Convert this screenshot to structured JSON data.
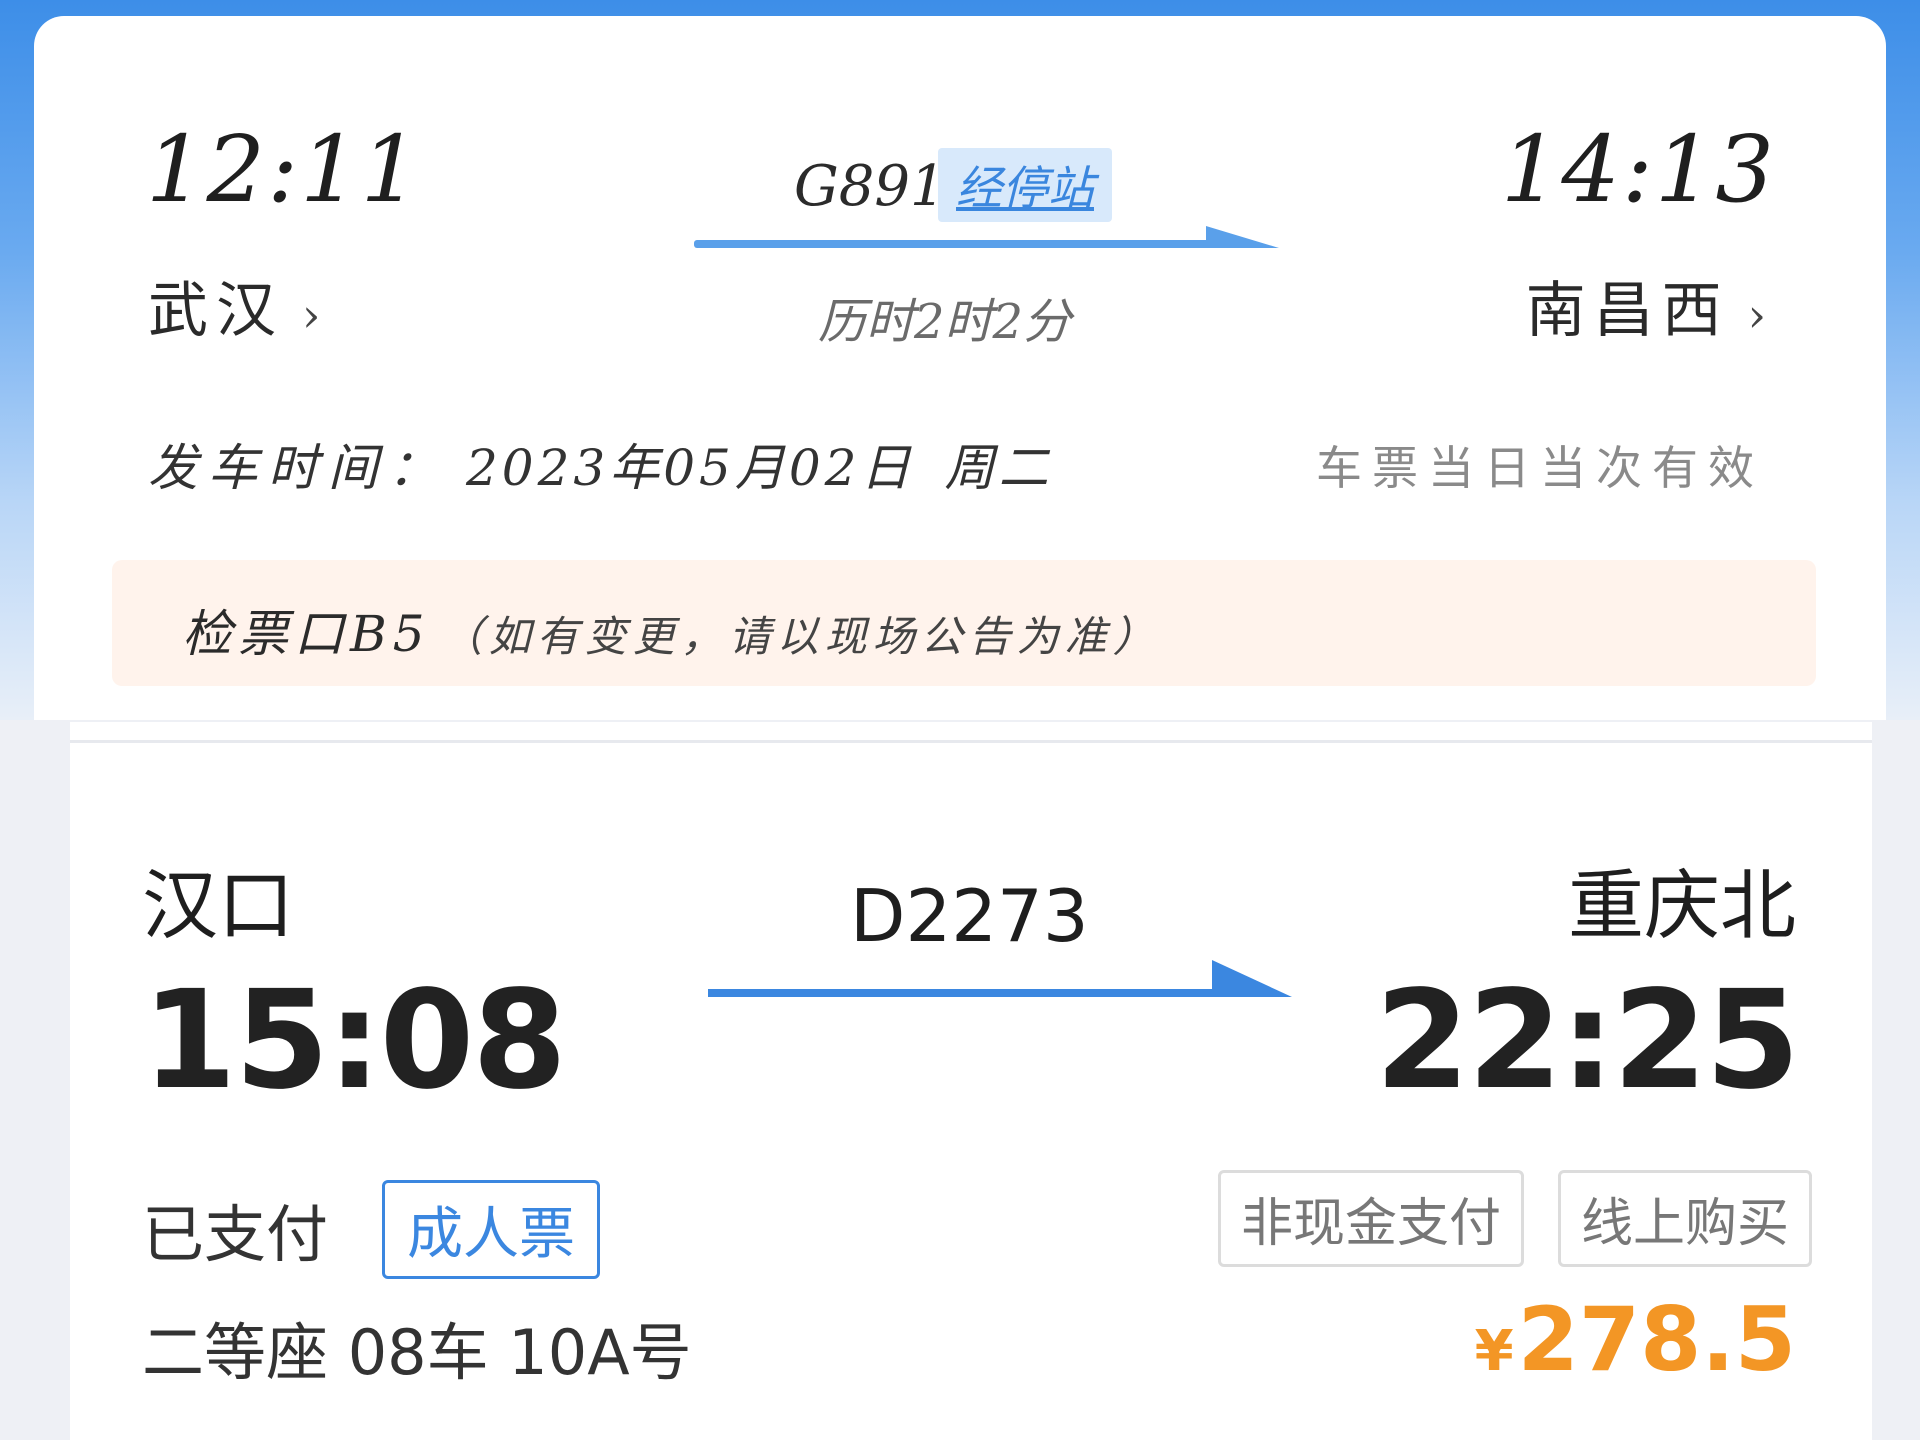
{
  "ticket1": {
    "departure_time": "12:11",
    "arrival_time": "14:13",
    "train_no": "G891",
    "stops_link": "经停站",
    "departure_station": "武汉",
    "arrival_station": "南昌西",
    "chevron": "›",
    "duration": "历时2时2分",
    "date_label": "发车时间：",
    "date_value": "2023年05月02日",
    "weekday": "周二",
    "validity": "车票当日当次有效",
    "gate": "检票口B5",
    "gate_note": "（如有变更，请以现场公告为准）"
  },
  "ticket2": {
    "departure_station": "汉口",
    "arrival_station": "重庆北",
    "train_no": "D2273",
    "departure_time": "15:08",
    "arrival_time": "22:25",
    "payment_status": "已支付",
    "ticket_type": "成人票",
    "tag_payment": "非现金支付",
    "tag_channel": "线上购买",
    "seat": "二等座 08车 10A号",
    "currency": "¥",
    "price": "278.5"
  },
  "colors": {
    "accent_blue": "#3b87e0",
    "price_orange": "#f39625",
    "gate_bg": "#fff3ec"
  }
}
